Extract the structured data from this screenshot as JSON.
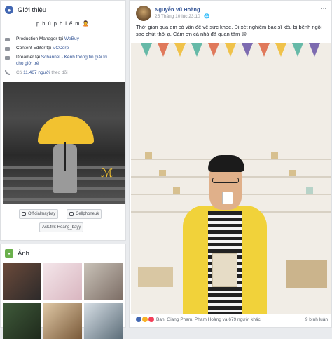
{
  "intro": {
    "title": "Giới thiệu",
    "bio": "p h ú p h i ế m 🙎",
    "rows": [
      {
        "text_a": "Production Manager tại ",
        "link": "WeBuy"
      },
      {
        "text_a": "Content Editor tại ",
        "link": "VCCorp"
      },
      {
        "text_a": "Dreamer tại ",
        "link": "Schannel - Kênh thông tin giải trí cho giới trẻ"
      }
    ],
    "followers_prefix": "Có ",
    "followers_link": "11.467 người",
    "followers_suffix": " theo dõi",
    "social": {
      "instagram": "Officialmaybay",
      "other": "Cellphoneuk",
      "ask": "Ask.fm: Hoang_bayy"
    }
  },
  "photos": {
    "title": "Ảnh"
  },
  "post": {
    "author": "Nguyễn Vũ Hoàng",
    "meta": "25 Tháng 10 lúc 23:10 · 🌐",
    "menu": "···",
    "text": "Thời gian qua em có vấn đề về sức khoẻ. Đi xét nghiệm bác sĩ kêu bị bệnh ngồi sao chút thôi ạ. Cám ơn cả nhà đã quan tâm 😊",
    "reactions_text": "Ban, Giang Pham, Pham Hoàng và 679 người khác",
    "comments_text": "9 bình luận"
  },
  "colors": {
    "link": "#385898",
    "brand": "#4267b2",
    "umbrella": "#f2c230",
    "raincoat": "#f1d23a"
  }
}
